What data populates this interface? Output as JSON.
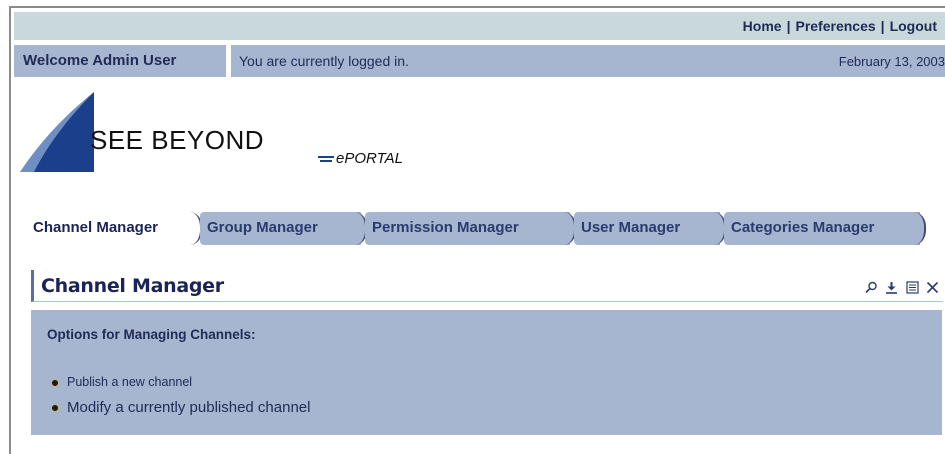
{
  "header": {
    "links": [
      "Home",
      "Preferences",
      "Logout"
    ],
    "welcome": "Welcome Admin User",
    "status": "You are currently logged in.",
    "date": "February 13, 2003"
  },
  "logo": {
    "brand": "SEE BEYOND",
    "product": "ePORTAL"
  },
  "tabs": [
    {
      "label": "Channel Manager",
      "active": true
    },
    {
      "label": "Group Manager",
      "active": false
    },
    {
      "label": "Permission Manager",
      "active": false
    },
    {
      "label": "User Manager",
      "active": false
    },
    {
      "label": "Categories Manager",
      "active": false
    }
  ],
  "section": {
    "title": "Channel Manager",
    "icons": [
      "search-icon",
      "download-icon",
      "edit-icon",
      "close-icon"
    ],
    "heading": "Options for Managing Channels:",
    "options": [
      "Publish a new channel",
      "Modify a currently published channel"
    ]
  },
  "colors": {
    "topbar": "#c9d9db",
    "bar": "#a7b6d0",
    "text": "#1f2a55",
    "logo_blue": "#1b3f8a"
  }
}
